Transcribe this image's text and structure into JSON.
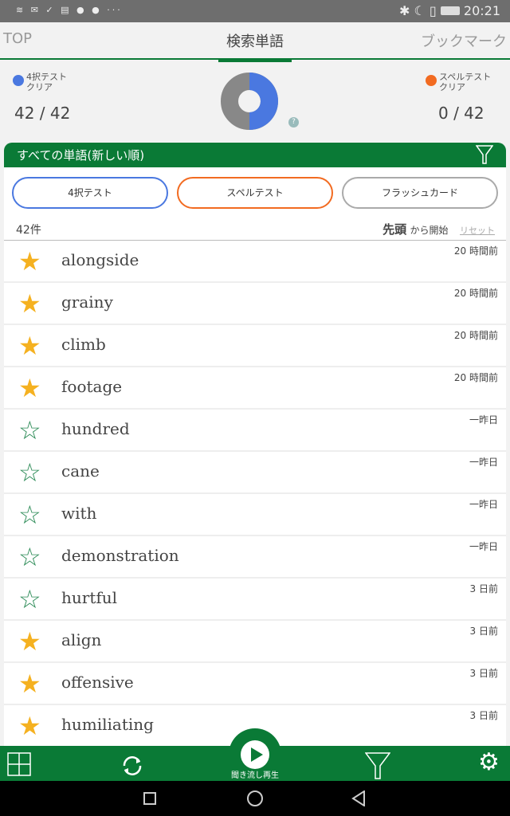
{
  "status_bar": {
    "left_icons": "≋ ✉ ✓ ▤ ● ● ···",
    "right_icons": "✱ ☾ ▯",
    "time": "20:21"
  },
  "tabs": [
    {
      "label": "TOP"
    },
    {
      "label": "検索単語",
      "active": true
    },
    {
      "label": "ブックマーク"
    }
  ],
  "stats": {
    "choice": {
      "label1": "4択テスト",
      "label2": "クリア",
      "value": "42 / 42",
      "color": "#4a78e0"
    },
    "spell": {
      "label1": "スペルテスト",
      "label2": "クリア",
      "value": "0 / 42",
      "color": "#f26b21"
    },
    "donut_fraction": 0.5,
    "help": "?"
  },
  "list_header": {
    "title": "すべての単語(新しい順)"
  },
  "buttons": {
    "choice": "4択テスト",
    "spell": "スペルテスト",
    "flash": "フラッシュカード"
  },
  "meta": {
    "count": "42件",
    "start_bold": "先頭",
    "start_rest": "から開始",
    "reset": "リセット"
  },
  "words": [
    {
      "word": "alongside",
      "time": "20 時間前",
      "starred": true
    },
    {
      "word": "grainy",
      "time": "20 時間前",
      "starred": true
    },
    {
      "word": "climb",
      "time": "20 時間前",
      "starred": true
    },
    {
      "word": "footage",
      "time": "20 時間前",
      "starred": true
    },
    {
      "word": "hundred",
      "time": "一昨日",
      "starred": false
    },
    {
      "word": "cane",
      "time": "一昨日",
      "starred": false
    },
    {
      "word": "with",
      "time": "一昨日",
      "starred": false
    },
    {
      "word": "demonstration",
      "time": "一昨日",
      "starred": false
    },
    {
      "word": "hurtful",
      "time": "3 日前",
      "starred": false
    },
    {
      "word": "align",
      "time": "3 日前",
      "starred": true
    },
    {
      "word": "offensive",
      "time": "3 日前",
      "starred": true
    },
    {
      "word": "humiliating",
      "time": "3 日前",
      "starred": true
    }
  ],
  "bottom_bar": {
    "play_label": "聞き流し再生"
  },
  "colors": {
    "green": "#0a7a36",
    "star": "#f5b120"
  }
}
